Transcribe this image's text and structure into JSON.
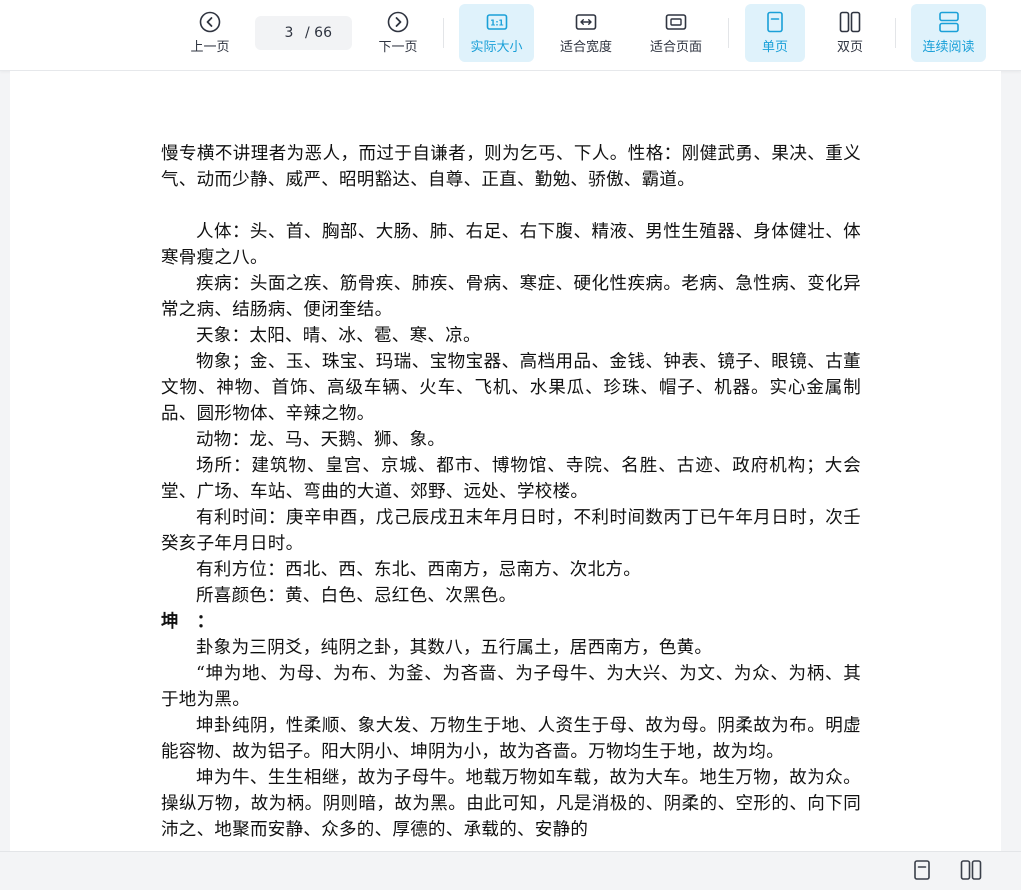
{
  "toolbar": {
    "prev_label": "上一页",
    "current_page": "3",
    "total_pages": "/ 66",
    "next_label": "下一页",
    "actual_size_label": "实际大小",
    "fit_width_label": "适合宽度",
    "fit_page_label": "适合页面",
    "single_page_label": "单页",
    "double_page_label": "双页",
    "continuous_label": "连续阅读"
  },
  "colors": {
    "accent": "#1aa0d8",
    "active_bg": "#dff2fb"
  },
  "document": {
    "paragraphs": [
      "慢专横不讲理者为恶人，而过于自谦者，则为乞丐、下人。性格：刚健武勇、果决、重义气、动而少静、威严、昭明豁达、自尊、正直、勤勉、骄傲、霸道。",
      "人体：头、首、胸部、大肠、肺、右足、右下腹、精液、男性生殖器、身体健壮、体寒骨瘦之八。",
      "疾病：头面之疾、筋骨疾、肺疾、骨病、寒症、硬化性疾病。老病、急性病、变化异常之病、结肠病、便闭奎结。",
      "天象：太阳、晴、冰、雹、寒、凉。",
      "物象；金、玉、珠宝、玛瑞、宝物宝器、高档用品、金钱、钟表、镜子、眼镜、古董文物、神物、首饰、高级车辆、火车、飞机、水果瓜、珍珠、帽子、机器。实心金属制品、圆形物体、辛辣之物。",
      "动物：龙、马、天鹅、狮、象。",
      "场所：建筑物、皇宫、京城、都市、博物馆、寺院、名胜、古迹、政府机构；大会堂、广场、车站、弯曲的大道、郊野、远处、学校楼。",
      "有利时间：庚辛申酉，戊己辰戌丑末年月日时，不利时间数丙丁已午年月日时，次壬癸亥子年月日时。",
      "有利方位：西北、西、东北、西南方，忌南方、次北方。",
      "所喜颜色：黄、白色、忌红色、次黑色。",
      "坤　：",
      "卦象为三阴爻，纯阴之卦，其数八，五行属土，居西南方，色黄。",
      "“坤为地、为母、为布、为釜、为吝啬、为子母牛、为大兴、为文、为众、为柄、其于地为黑。",
      "坤卦纯阴，性柔顺、象大发、万物生于地、人资生于母、故为母。阴柔故为布。明虚能容物、故为铝子。阳大阴小、坤阴为小，故为吝啬。万物均生于地，故为均。",
      "坤为牛、生生相继，故为子母牛。地载万物如车载，故为大车。地生万物，故为众。操纵万物，故为柄。阴则暗，故为黑。由此可知，凡是消极的、阴柔的、空形的、向下同沛之、地聚而安静、众多的、厚德的、承载的、安静的"
    ]
  }
}
